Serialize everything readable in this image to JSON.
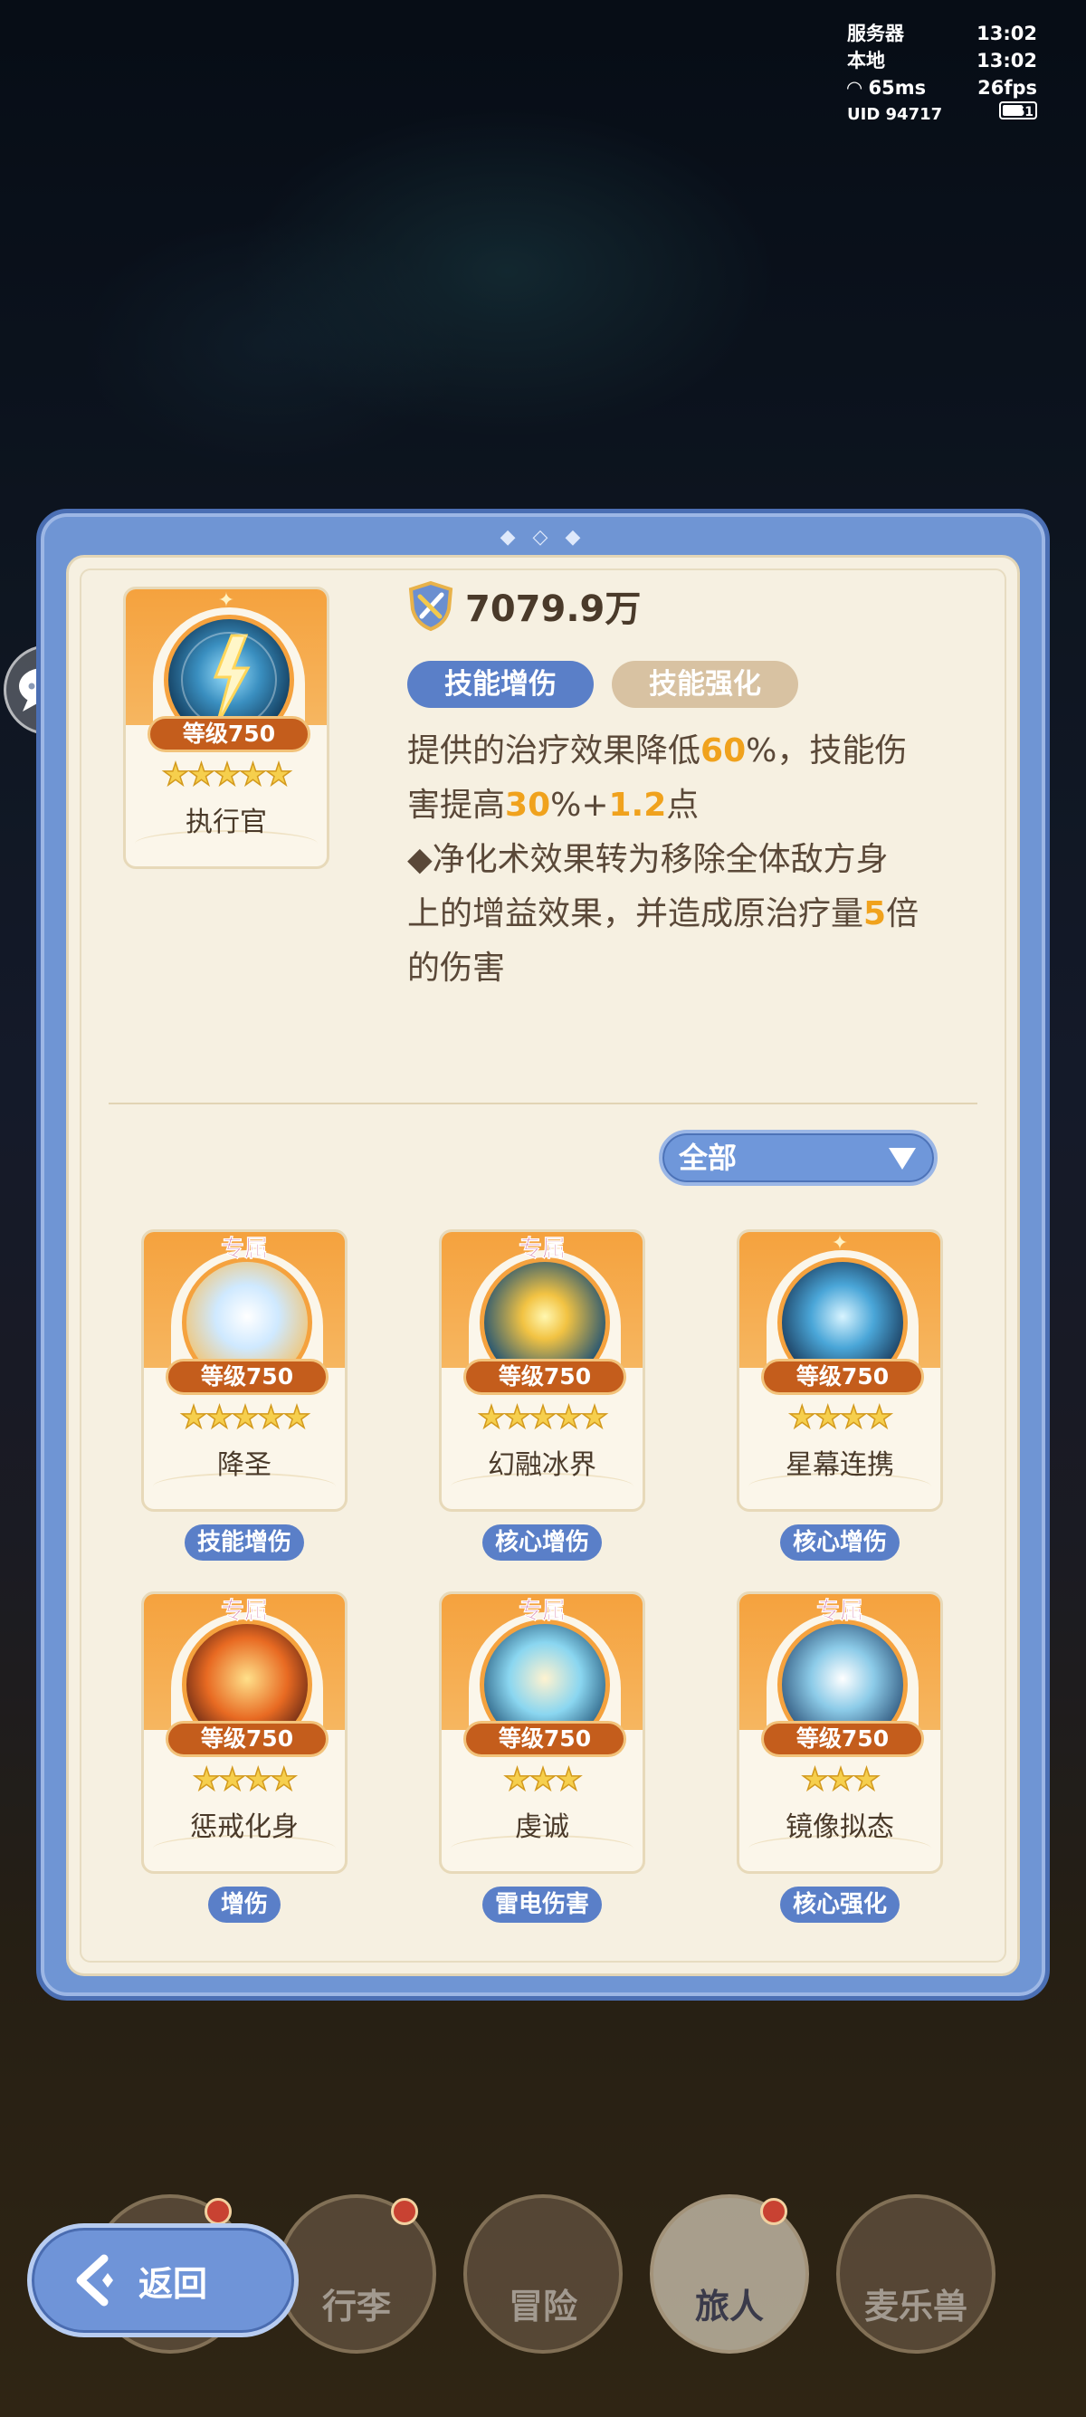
{
  "status": {
    "server_label": "服务器",
    "server_time": "13:02",
    "local_label": "本地",
    "local_time": "13:02",
    "ping": "65ms",
    "fps": "26fps",
    "uid": "UID 94717",
    "battery": "61"
  },
  "hero": {
    "level": "等级750",
    "name": "执行官",
    "stars": "★★★★★"
  },
  "power": "7079.9万",
  "tabs": {
    "active": "技能增伤",
    "inactive": "技能强化"
  },
  "description": {
    "line1_a": "提供的治疗效果降低",
    "line1_v": "60",
    "line1_b": "%，技能伤",
    "line2_a": "害提高",
    "line2_v1": "30",
    "line2_b": "%+",
    "line2_v2": "1.2",
    "line2_c": "点",
    "line3": "◆净化术效果转为移除全体敌方身",
    "line4_a": "上的增益效果，并造成原治疗量",
    "line4_v": "5",
    "line4_b": "倍",
    "line5": "的伤害"
  },
  "filter": {
    "selected": "全部"
  },
  "exclusive_label": "专属",
  "skills": [
    {
      "name": "降圣",
      "level": "等级750",
      "stars": "★★★★★",
      "tag": "技能增伤",
      "exclusive": true
    },
    {
      "name": "幻融冰界",
      "level": "等级750",
      "stars": "★★★★★",
      "tag": "核心增伤",
      "exclusive": true
    },
    {
      "name": "星幕连携",
      "level": "等级750",
      "stars": "★★★★",
      "tag": "核心增伤",
      "exclusive": false
    },
    {
      "name": "惩戒化身",
      "level": "等级750",
      "stars": "★★★★",
      "tag": "增伤",
      "exclusive": true
    },
    {
      "name": "虔诚",
      "level": "等级750",
      "stars": "★★★",
      "tag": "雷电伤害",
      "exclusive": true
    },
    {
      "name": "镜像拟态",
      "level": "等级750",
      "stars": "★★★",
      "tag": "核心强化",
      "exclusive": true
    }
  ],
  "nav": {
    "back": "返回",
    "items": [
      "行李",
      "冒险",
      "旅人",
      "麦乐兽"
    ]
  },
  "colors": {
    "accent_blue": "#5a7fc8",
    "highlight": "#f0a21d",
    "panel_bg": "#f6f0e1"
  }
}
